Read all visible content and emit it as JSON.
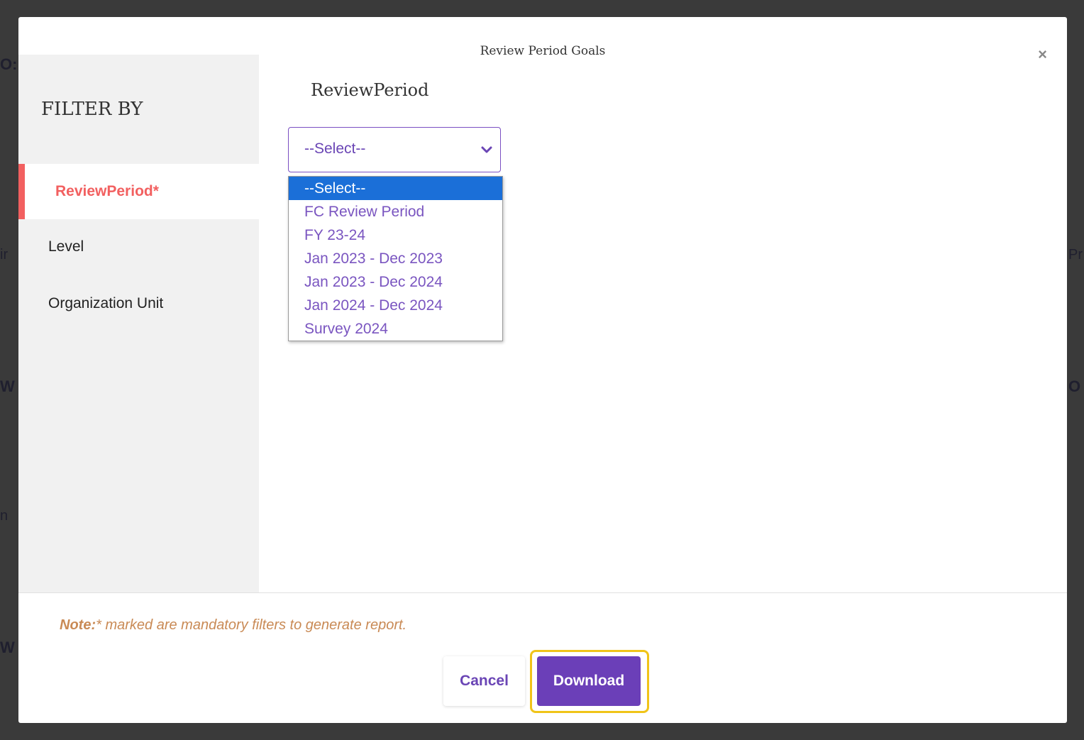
{
  "modal": {
    "title": "Review Period Goals",
    "close_symbol": "×"
  },
  "sidebar": {
    "heading": "FILTER BY",
    "items": [
      {
        "label": "ReviewPeriod*",
        "active": true
      },
      {
        "label": "Level",
        "active": false
      },
      {
        "label": "Organization Unit",
        "active": false
      }
    ]
  },
  "review_period": {
    "label": "ReviewPeriod",
    "selected_value": "--Select--",
    "options": [
      "--Select--",
      "FC Review Period",
      "FY 23-24",
      "Jan 2023 - Dec 2023",
      "Jan 2023 - Dec 2024",
      "Jan 2024 - Dec 2024",
      "Survey 2024"
    ],
    "highlighted_option": "--Select--"
  },
  "footer": {
    "note_prefix": "Note:",
    "note_text": "* marked are mandatory filters to generate report.",
    "cancel_label": "Cancel",
    "download_label": "Download"
  },
  "colors": {
    "accent_purple": "#6b3fb8",
    "active_red": "#f26060",
    "option_highlight": "#1b6fd8",
    "note_orange": "#c98a55",
    "focus_yellow": "#f0c419"
  },
  "icons": {
    "close": "close-icon",
    "select_chevron": "chevron-down-icon"
  }
}
